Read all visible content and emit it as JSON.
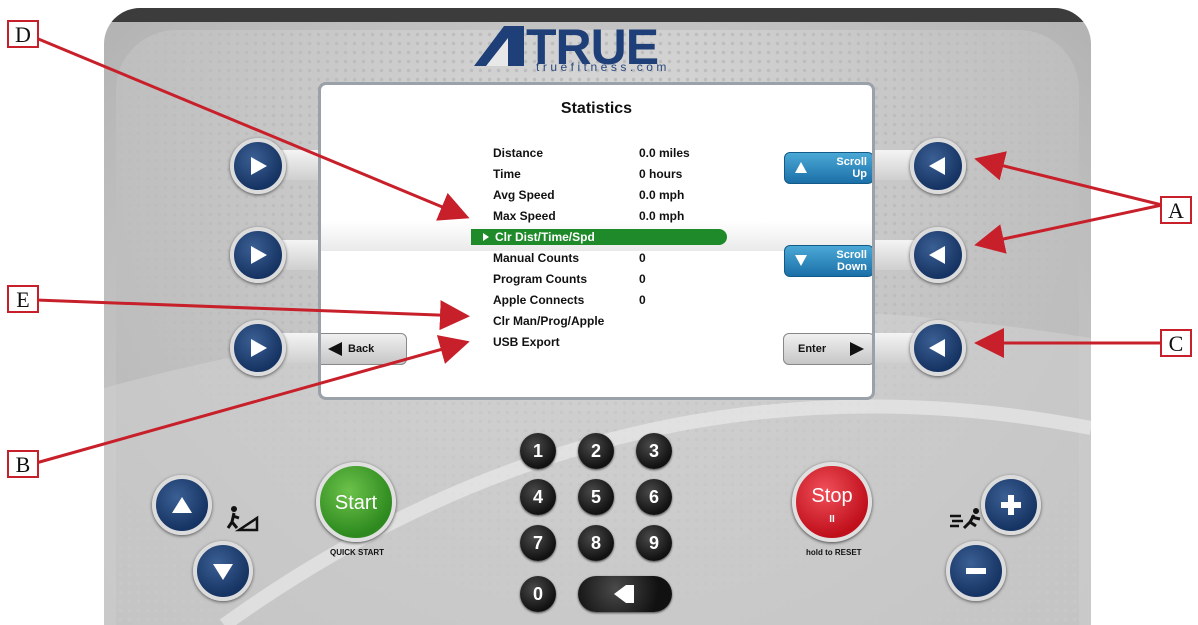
{
  "brand": {
    "logo": "TRUE",
    "url": "truefitness.com"
  },
  "screen": {
    "title": "Statistics",
    "rows": [
      {
        "label": "Distance",
        "value": "0.0 miles"
      },
      {
        "label": "Time",
        "value": "0 hours"
      },
      {
        "label": "Avg Speed",
        "value": "0.0 mph"
      },
      {
        "label": "Max Speed",
        "value": "0.0 mph"
      },
      {
        "label": "Clr Dist/Time/Spd",
        "value": ""
      },
      {
        "label": "Manual Counts",
        "value": "0"
      },
      {
        "label": "Program Counts",
        "value": "0"
      },
      {
        "label": "Apple Connects",
        "value": "0"
      },
      {
        "label": "Clr Man/Prog/Apple",
        "value": ""
      },
      {
        "label": "USB Export",
        "value": ""
      }
    ],
    "scroll_up": {
      "line1": "Scroll",
      "line2": "Up"
    },
    "scroll_down": {
      "line1": "Scroll",
      "line2": "Down"
    },
    "back": "Back",
    "enter": "Enter"
  },
  "keypad": [
    "1",
    "2",
    "3",
    "4",
    "5",
    "6",
    "7",
    "8",
    "9",
    "0"
  ],
  "start": {
    "label": "Start",
    "caption": "QUICK START"
  },
  "stop": {
    "label": "Stop",
    "sub": "II",
    "caption": "hold to RESET"
  },
  "callouts": [
    "A",
    "B",
    "C",
    "D",
    "E"
  ],
  "colors": {
    "accent_red": "#c8202a",
    "console_blue": "#163463",
    "highlight_green": "#1f8a2a",
    "start_green": "#3b9a2a",
    "stop_red": "#d8202a"
  }
}
